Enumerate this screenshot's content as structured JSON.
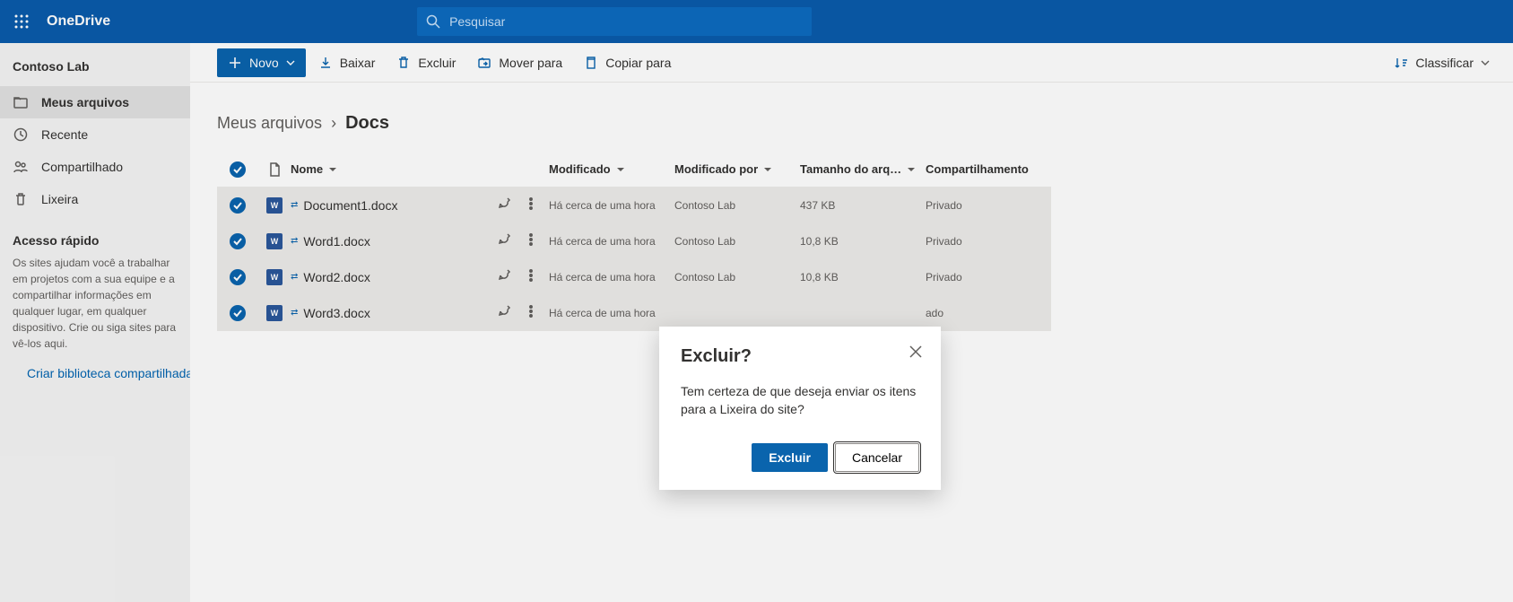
{
  "header": {
    "brand": "OneDrive",
    "searchPlaceholder": "Pesquisar"
  },
  "sidebar": {
    "tenant": "Contoso Lab",
    "items": [
      {
        "label": "Meus arquivos"
      },
      {
        "label": "Recente"
      },
      {
        "label": "Compartilhado"
      },
      {
        "label": "Lixeira"
      }
    ],
    "quickTitle": "Acesso rápido",
    "quickText": "Os sites ajudam você a trabalhar em projetos com a sua equipe e a compartilhar informações em qualquer lugar, em qualquer dispositivo. Crie ou siga sites para vê-los aqui.",
    "quickLink": "Criar biblioteca compartilhada"
  },
  "cmd": {
    "new": "Novo",
    "download": "Baixar",
    "delete": "Excluir",
    "move": "Mover para",
    "copy": "Copiar para",
    "sort": "Classificar"
  },
  "breadcrumb": {
    "root": "Meus arquivos",
    "current": "Docs"
  },
  "columns": {
    "name": "Nome",
    "modified": "Modificado",
    "modifiedBy": "Modificado por",
    "size": "Tamanho do arq…",
    "sharing": "Compartilhamento"
  },
  "rows": [
    {
      "name": "Document1.docx",
      "modified": "Há cerca de uma hora",
      "by": "Contoso Lab",
      "size": "437 KB",
      "sharing": "Privado"
    },
    {
      "name": "Word1.docx",
      "modified": "Há cerca de uma hora",
      "by": "Contoso Lab",
      "size": "10,8 KB",
      "sharing": "Privado"
    },
    {
      "name": "Word2.docx",
      "modified": "Há cerca de uma hora",
      "by": "Contoso Lab",
      "size": "10,8 KB",
      "sharing": "Privado"
    },
    {
      "name": "Word3.docx",
      "modified": "Há cerca de uma hora",
      "by": "",
      "size": "",
      "sharing": "ado"
    }
  ],
  "dialog": {
    "title": "Excluir?",
    "body": "Tem certeza de que deseja enviar os itens para a Lixeira do site?",
    "confirm": "Excluir",
    "cancel": "Cancelar"
  }
}
